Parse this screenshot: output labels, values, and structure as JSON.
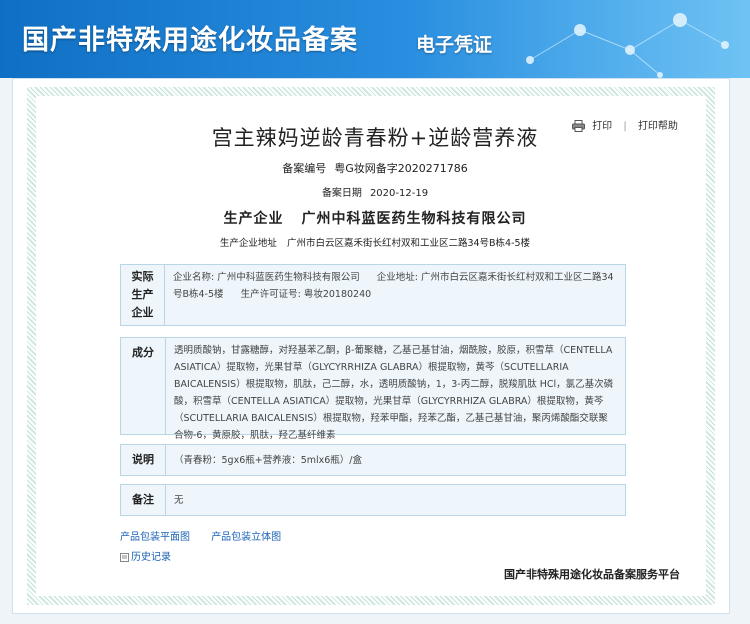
{
  "header": {
    "title": "国产非特殊用途化妆品备案",
    "subtitle": "电子凭证"
  },
  "toolbar": {
    "print_label": "打印",
    "separator": "|",
    "print_help_label": "打印帮助"
  },
  "product": {
    "name": "宫主辣妈逆龄青春粉+逆龄营养液",
    "record_no_label": "备案编号",
    "record_no": "粤G妆网备字2020271786",
    "record_date_label": "备案日期",
    "record_date": "2020-12-19",
    "company_label": "生产企业",
    "company_name": "广州中科蓝医药生物科技有限公司",
    "company_addr_label": "生产企业地址",
    "company_addr": "广州市白云区嘉禾街长红村双和工业区二路34号B栋4-5楼"
  },
  "actual_producer": {
    "label": "实际生产企业",
    "name_label": "企业名称:",
    "name": "广州中科蓝医药生物科技有限公司",
    "addr_label": "企业地址:",
    "addr": "广州市白云区嘉禾街长红村双和工业区二路34号B栋4-5楼",
    "license_label": "生产许可证号:",
    "license": "粤妆20180240"
  },
  "ingredients": {
    "label": "成分",
    "text": "透明质酸钠，甘露糖醇，对羟基苯乙酮，β-葡聚糖，乙基己基甘油，烟酰胺，胶原，积雪草（CENTELLA ASIATICA）提取物，光果甘草（GLYCYRRHIZA GLABRA）根提取物，黄芩（SCUTELLARIA BAICALENSIS）根提取物，肌肽，己二醇，水，透明质酸钠，1，3-丙二醇，脱羧肌肽 HCl，氯乙基次磷酸，积雪草（CENTELLA ASIATICA）提取物，光果甘草（GLYCYRRHIZA GLABRA）根提取物，黄芩（SCUTELLARIA BAICALENSIS）根提取物，羟苯甲酯，羟苯乙酯，乙基己基甘油，聚丙烯酸酯交联聚合物-6，黄原胶，肌肽，羟乙基纤维素"
  },
  "description": {
    "label": "说明",
    "text": "（青春粉：5gx6瓶+营养液：5mlx6瓶）/盒"
  },
  "remark": {
    "label": "备注",
    "text": "无"
  },
  "links": {
    "flat_view": "产品包装平面图",
    "3d_view": "产品包装立体图",
    "history": "历史记录"
  },
  "footer": {
    "service_platform": "国产非特殊用途化妆品备案服务平台"
  },
  "colors": {
    "banner_start": "#0f6fc4",
    "banner_end": "#6fc3f4",
    "link": "#1c63b7",
    "box_bg": "#eef6fb",
    "box_border": "#b9d6e6"
  }
}
